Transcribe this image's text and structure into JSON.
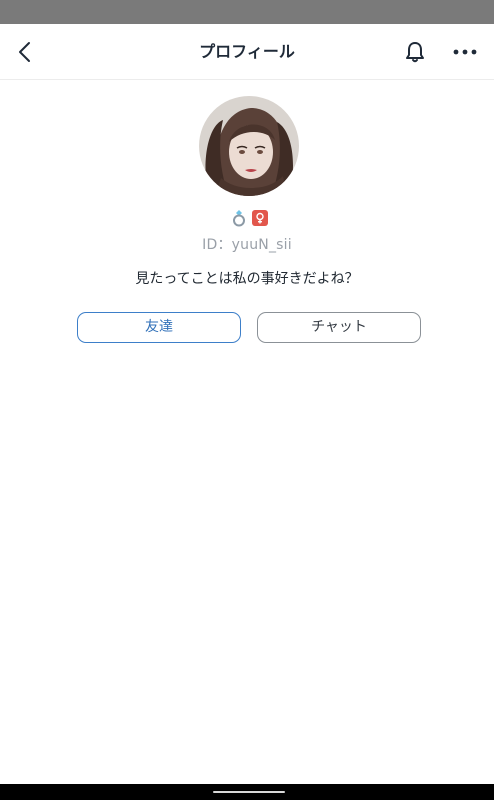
{
  "header": {
    "title": "プロフィール",
    "icons": [
      "back-icon",
      "bell-icon",
      "more-icon"
    ]
  },
  "profile": {
    "id_label": "ID：yuuN_sii",
    "bio": "見たってことは私の事好きだよね？",
    "badges": [
      "ring-icon",
      "female-icon"
    ]
  },
  "actions": {
    "friend_label": "友達",
    "chat_label": "チャット"
  },
  "colors": {
    "accent": "#3d7fc9",
    "title": "#1f2a38",
    "muted": "#9aa0a8",
    "gender_badge": "#e2574c"
  }
}
